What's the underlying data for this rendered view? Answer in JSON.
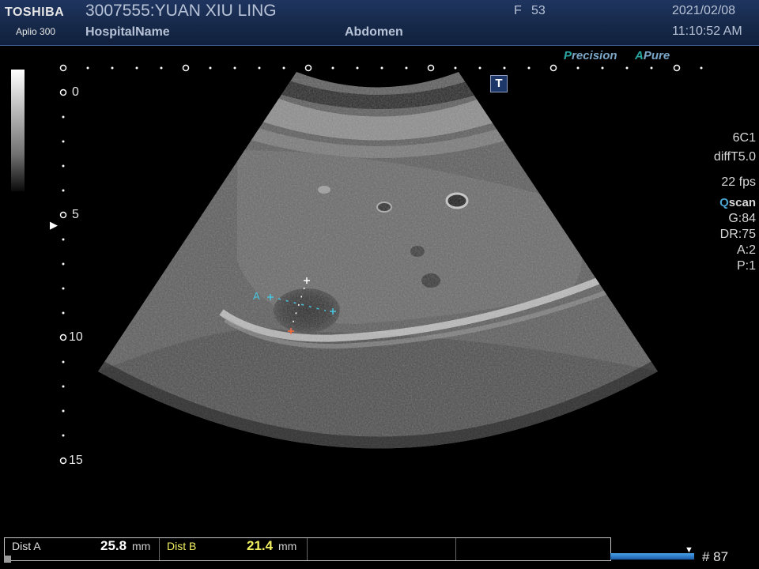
{
  "header": {
    "brand": "TOSHIBA",
    "model": "Aplio 300",
    "patient": "3007555:YUAN XIU LING",
    "hospital": "HospitalName",
    "exam": "Abdomen",
    "sex": "F",
    "age": "53",
    "date": "2021/02/08",
    "time": "11:10:52 AM"
  },
  "image_mode": {
    "precision_first": "P",
    "precision_rest": "recision",
    "apure_first": "A",
    "apure_rest": "Pure",
    "t_button": "T"
  },
  "scan_params": {
    "probe": "6C1",
    "mode": "diffT5.0",
    "fps": "22 fps",
    "qscan_first": "Q",
    "qscan_rest": "scan",
    "gain": "G:84",
    "dr": "DR:75",
    "a": "A:2",
    "p": "P:1"
  },
  "depth_scale": [
    "0",
    "5",
    "10",
    "15"
  ],
  "caliper_label": "A",
  "measurements": [
    {
      "name": "Dist A",
      "value": "25.8",
      "unit": "mm",
      "value_color": "#ffffff"
    },
    {
      "name": "Dist B",
      "value": "21.4",
      "unit": "mm",
      "value_color": "#f0f060"
    }
  ],
  "frame": "# 87",
  "colors": {
    "header_bg": "#162848",
    "header_text": "#b7c2d6",
    "accent_teal": "#2aa6a0",
    "caliper_cyan": "#49c7e0",
    "cine_blue": "#2a7ad0"
  }
}
